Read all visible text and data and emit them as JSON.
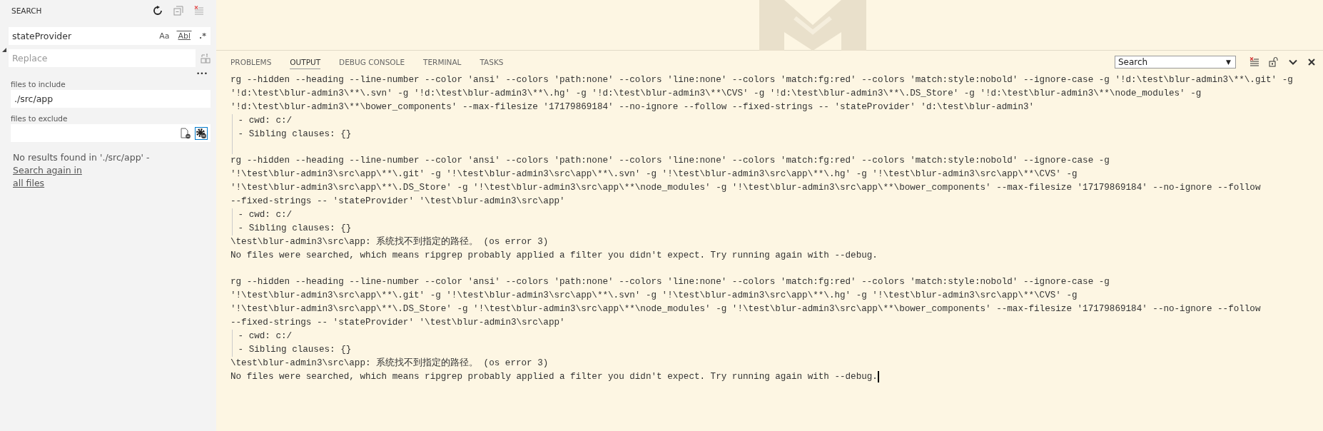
{
  "sidebar": {
    "title": "SEARCH",
    "search": {
      "value": "stateProvider",
      "toggles": [
        {
          "label": "Aa",
          "kind": "case",
          "selected": false
        },
        {
          "label": "Abl",
          "kind": "word",
          "selected": false
        },
        {
          "label": ".*",
          "kind": "regex",
          "selected": false
        }
      ]
    },
    "replace": {
      "expanded": true,
      "placeholder": "Replace"
    },
    "details_toggle": "•••",
    "include": {
      "label": "files to include",
      "value": "./src/app"
    },
    "exclude": {
      "label": "files to exclude",
      "use_settings": true
    },
    "message": {
      "text": "No results found in './src/app' - ",
      "link": "Search again in all files"
    }
  },
  "panel": {
    "tabs": [
      {
        "label": "PROBLEMS",
        "selected": false
      },
      {
        "label": "OUTPUT",
        "selected": true
      },
      {
        "label": "DEBUG CONSOLE",
        "selected": false
      },
      {
        "label": "TERMINAL",
        "selected": false
      },
      {
        "label": "TASKS",
        "selected": false
      }
    ],
    "channel": "Search",
    "channel_caret": "▼",
    "output": [
      {
        "kind": "text",
        "text": "rg --hidden --heading --line-number --color 'ansi' --colors 'path:none' --colors 'line:none' --colors 'match:fg:red' --colors 'match:style:nobold' --ignore-case -g '!d:\\test\\blur-admin3\\**\\.git' -g"
      },
      {
        "kind": "text",
        "text": "'!d:\\test\\blur-admin3\\**\\.svn' -g '!d:\\test\\blur-admin3\\**\\.hg' -g '!d:\\test\\blur-admin3\\**\\CVS' -g '!d:\\test\\blur-admin3\\**\\.DS_Store' -g '!d:\\test\\blur-admin3\\**\\node_modules' -g"
      },
      {
        "kind": "text",
        "text": "'!d:\\test\\blur-admin3\\**\\bower_components' --max-filesize '17179869184' --no-ignore --follow --fixed-strings -- 'stateProvider' 'd:\\test\\blur-admin3'"
      },
      {
        "kind": "detail",
        "text": " - cwd: c:/"
      },
      {
        "kind": "detail",
        "text": " - Sibling clauses: {}"
      },
      {
        "kind": "detail"
      },
      {
        "kind": "text",
        "text": "rg --hidden --heading --line-number --color 'ansi' --colors 'path:none' --colors 'line:none' --colors 'match:fg:red' --colors 'match:style:nobold' --ignore-case -g"
      },
      {
        "kind": "text",
        "text": "'!\\test\\blur-admin3\\src\\app\\**\\.git' -g '!\\test\\blur-admin3\\src\\app\\**\\.svn' -g '!\\test\\blur-admin3\\src\\app\\**\\.hg' -g '!\\test\\blur-admin3\\src\\app\\**\\CVS' -g"
      },
      {
        "kind": "text",
        "text": "'!\\test\\blur-admin3\\src\\app\\**\\.DS_Store' -g '!\\test\\blur-admin3\\src\\app\\**\\node_modules' -g '!\\test\\blur-admin3\\src\\app\\**\\bower_components' --max-filesize '17179869184' --no-ignore --follow"
      },
      {
        "kind": "text",
        "text": "--fixed-strings -- 'stateProvider' '\\test\\blur-admin3\\src\\app'"
      },
      {
        "kind": "detail",
        "text": " - cwd: c:/"
      },
      {
        "kind": "detail",
        "text": " - Sibling clauses: {}"
      },
      {
        "kind": "text",
        "text": "\\test\\blur-admin3\\src\\app: 系统找不到指定的路径。 (os error 3)"
      },
      {
        "kind": "text",
        "text": "No files were searched, which means ripgrep probably applied a filter you didn't expect. Try running again with --debug."
      },
      {
        "kind": "blank"
      },
      {
        "kind": "text",
        "text": "rg --hidden --heading --line-number --color 'ansi' --colors 'path:none' --colors 'line:none' --colors 'match:fg:red' --colors 'match:style:nobold' --ignore-case -g"
      },
      {
        "kind": "text",
        "text": "'!\\test\\blur-admin3\\src\\app\\**\\.git' -g '!\\test\\blur-admin3\\src\\app\\**\\.svn' -g '!\\test\\blur-admin3\\src\\app\\**\\.hg' -g '!\\test\\blur-admin3\\src\\app\\**\\CVS' -g"
      },
      {
        "kind": "text",
        "text": "'!\\test\\blur-admin3\\src\\app\\**\\.DS_Store' -g '!\\test\\blur-admin3\\src\\app\\**\\node_modules' -g '!\\test\\blur-admin3\\src\\app\\**\\bower_components' --max-filesize '17179869184' --no-ignore --follow"
      },
      {
        "kind": "text",
        "text": "--fixed-strings -- 'stateProvider' '\\test\\blur-admin3\\src\\app'"
      },
      {
        "kind": "detail",
        "text": " - cwd: c:/"
      },
      {
        "kind": "detail",
        "text": " - Sibling clauses: {}"
      },
      {
        "kind": "text",
        "text": "\\test\\blur-admin3\\src\\app: 系统找不到指定的路径。 (os error 3)"
      },
      {
        "kind": "text",
        "text": "No files were searched, which means ripgrep probably applied a filter you didn't expect. Try running again with --debug.",
        "caret": true
      }
    ]
  }
}
